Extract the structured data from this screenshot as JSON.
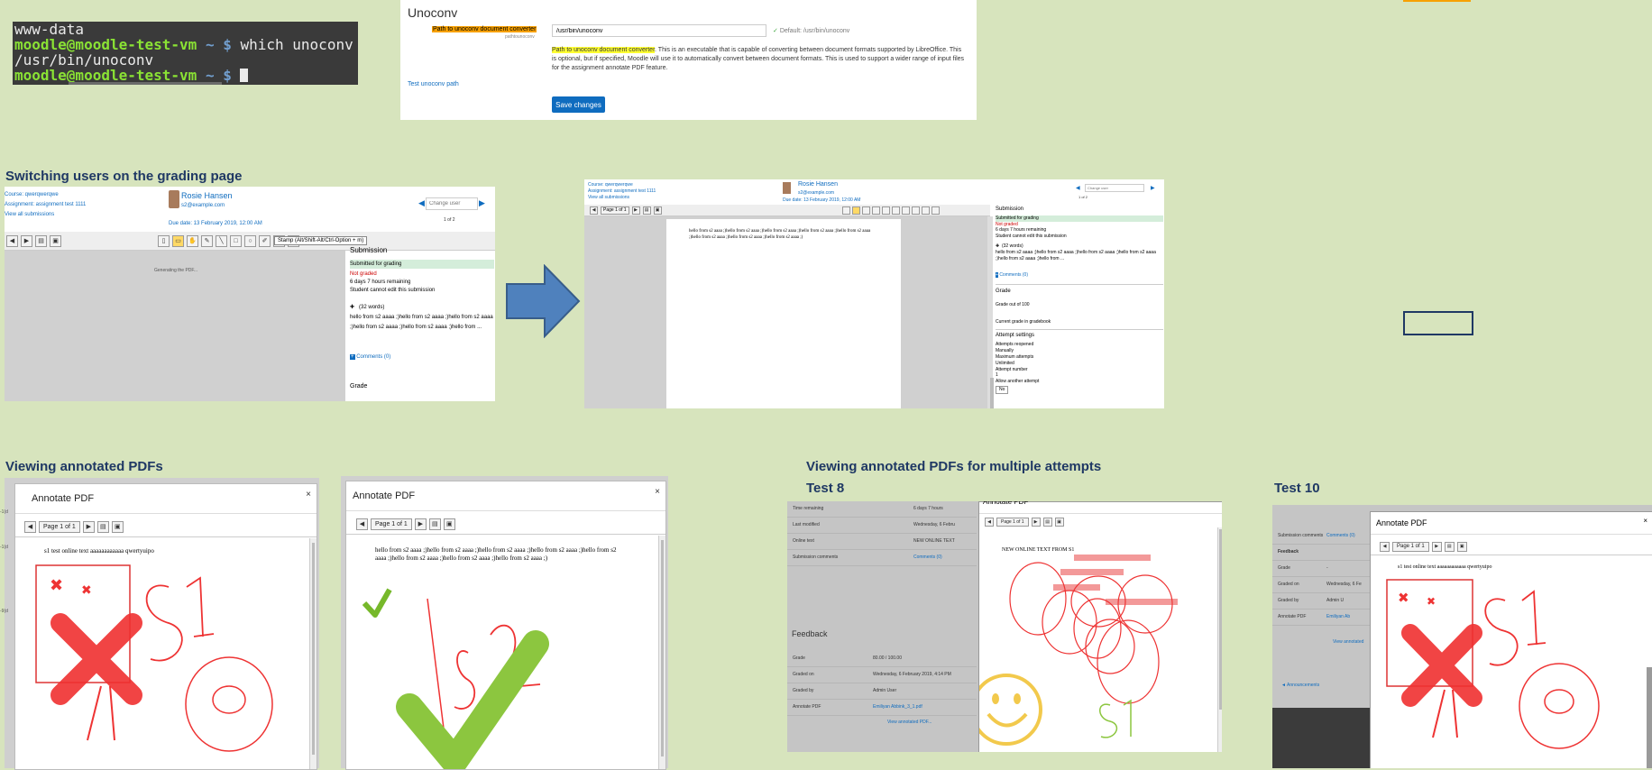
{
  "terminal": {
    "line1": "www-data",
    "prompt_user": "moodle@moodle-test-vm",
    "prompt_path": "~ $",
    "command": "which unoconv",
    "output": "/usr/bin/unoconv"
  },
  "unoconv": {
    "heading": "Unoconv",
    "setting_label": "Path to unoconv document converter",
    "setting_key": "pathtounoconv",
    "input_value": "/usr/bin/unoconv",
    "default_text": "Default: /usr/bin/unoconv",
    "desc_highlight": "Path to unoconv document converter",
    "desc_rest": ". This is an executable that is capable of converting between document formats supported by LibreOffice. This is optional, but if specified, Moodle will use it to automatically convert between document formats. This is used to support a wider range of input files for the assignment annotate PDF feature.",
    "test_link": "Test unoconv path",
    "save_button": "Save changes"
  },
  "switching": {
    "title": "Switching users on the grading page",
    "course_link": "Course: qwerqwerqwe",
    "assignment_link": "Assignment: assignment test 1111",
    "view_all": "View all submissions",
    "user_name": "Rosie Hansen",
    "user_email": "s2@example.com",
    "due_date": "Due date: 13 February 2019, 12:00 AM",
    "change_user_placeholder": "Change user",
    "count": "1 of 2",
    "stamp_label": "Stamp (Alt/Shift-Alt/Ctrl-Option + m)",
    "generating": "Generating the PDF...",
    "submission_heading": "Submission",
    "submitted_for_grading": "Submitted for grading",
    "not_graded": "Not graded",
    "days_remaining": "6 days 7 hours remaining",
    "cannot_edit": "Student cannot edit this submission",
    "word_count": "(32 words)",
    "online_text": "hello from s2 aaaa ;)hello from s2 aaaa ;)hello from s2 aaaa ;)hello from s2 aaaa ;)hello from s2 aaaa ;)hello from ...",
    "comments": "Comments (0)",
    "grade_heading": "Grade"
  },
  "after": {
    "course_link": "Course: qwerqwerqwe",
    "assignment_link": "Assignment: assignment test 1111",
    "view_all": "View all submissions",
    "user_name": "Rosie Hansen",
    "user_email": "s2@example.com",
    "due_date": "Due date: 13 February 2019, 12:00 AM",
    "change_user_placeholder": "Change user",
    "count": "1 of 2",
    "page_label": "Page 1 of 1",
    "pdf_text": "hello from s2 aaaa ;)hello from s2 aaaa ;)hello from s2 aaaa ;)hello from s2 aaaa ;)hello from s2 aaaa ;)hello from s2 aaaa ;)hello from s2 aaaa ;)hello from s2 aaaa ;)",
    "submission_heading": "Submission",
    "submitted_for_grading": "Submitted for grading",
    "not_graded": "Not graded",
    "days_remaining": "6 days 7 hours remaining",
    "cannot_edit": "Student cannot edit this submission",
    "word_count": "(32 words)",
    "online_text": "hello from s2 aaaa ;)hello from s2 aaaa ;)hello from s2 aaaa ;)hello from s2 aaaa ;)hello from s2 aaaa ;)hello from ...",
    "comments": "Comments (0)",
    "grade_heading": "Grade",
    "grade_out_of": "Grade out of 100",
    "current_grade": "Current grade in gradebook",
    "attempt_settings": "Attempt settings",
    "attempts_reopened": "Attempts reopened",
    "manually": "Manually",
    "max_attempts": "Maximum attempts",
    "unlimited": "Unlimited",
    "attempt_number": "Attempt number",
    "attempt_value": "1",
    "allow_another": "Allow another attempt",
    "allow_value": "No"
  },
  "viewing": {
    "title": "Viewing annotated PDFs",
    "modal_title": "Annotate PDF",
    "page_label": "Page 1 of 1",
    "s1_text": "s1 test online text aaaaaaaaaaaa qwertyuipo",
    "s2_text": "hello from s2 aaaa ;)hello from s2 aaaa ;)hello from s2 aaaa ;)hello from s2 aaaa ;)hello from s2 aaaa ;)hello from s2 aaaa ;)hello from s2 aaaa ;)hello from s2 aaaa ;)",
    "close": "×"
  },
  "multiple": {
    "title": "Viewing annotated PDFs for multiple attempts",
    "test8": "Test 8",
    "test10": "Test 10",
    "modal_title": "Annotate PDF",
    "page_label": "Page 1 of 1",
    "t8_rows": [
      {
        "label": "Time remaining",
        "value": "6 days 7 hours"
      },
      {
        "label": "Last modified",
        "value": "Wednesday, 6 Febru"
      },
      {
        "label": "Online text",
        "value": "NEW ONLINE TEXT"
      },
      {
        "label": "Submission comments",
        "value": "Comments (0)"
      }
    ],
    "feedback": "Feedback",
    "t8_feedback_rows": [
      {
        "label": "Grade",
        "value": "80.00 / 100.00"
      },
      {
        "label": "Graded on",
        "value": "Wednesday, 6 February 2019, 4:14 PM"
      },
      {
        "label": "Graded by",
        "value": "Admin User"
      },
      {
        "label": "Annotate PDF",
        "value": "Emiliyan Abbink_3_1.pdf"
      }
    ],
    "view_annotated": "View annotated PDF...",
    "t8_pdf_text": "NEW ONLINE TEXT FROM S1",
    "t10_rows": [
      {
        "label": "Submission comments",
        "value": "Comments (0)"
      },
      {
        "label": "Feedback",
        "value": ""
      },
      {
        "label": "Grade",
        "value": "-"
      },
      {
        "label": "Graded on",
        "value": "Wednesday, 6 Fe"
      },
      {
        "label": "Graded by",
        "value": "Admin U"
      },
      {
        "label": "Annotate PDF",
        "value": "Emiliyan Ab"
      }
    ],
    "t10_view_annotated": "View annotated",
    "announcements": "◄ Announcements",
    "t10_pdf_text": "s1 test online text aaaaaaaaaaaa qwertyuipo"
  }
}
